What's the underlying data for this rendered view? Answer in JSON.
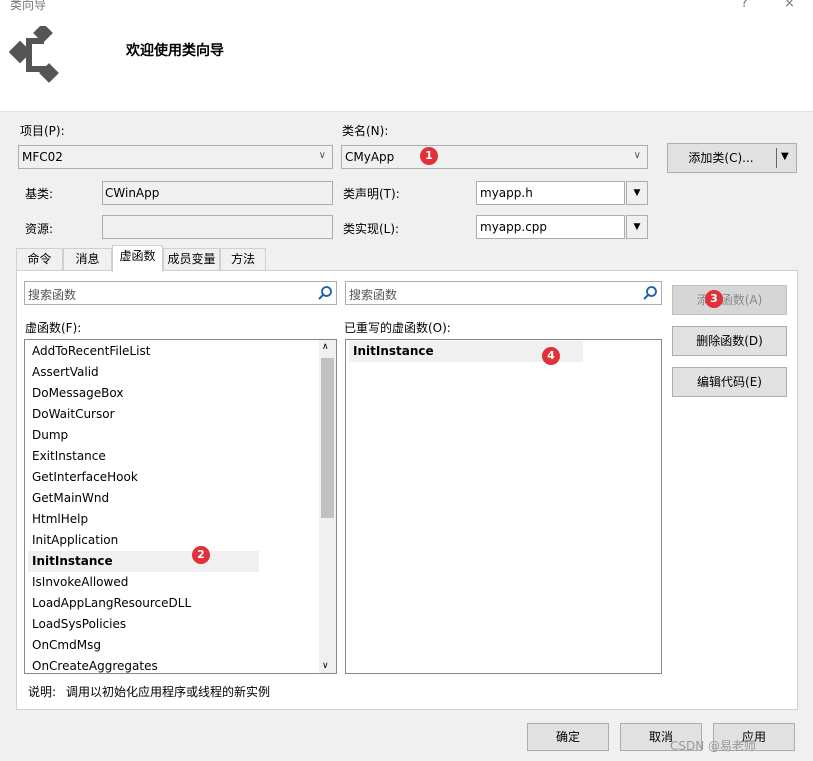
{
  "window": {
    "title": "类向导",
    "help_label": "?",
    "close_label": "×"
  },
  "header": {
    "title": "欢迎使用类向导"
  },
  "form": {
    "project_label": "项目(P):",
    "project_value": "MFC02",
    "class_label": "类名(N):",
    "class_value": "CMyApp",
    "add_class_label": "添加类(C)...",
    "base_label": "基类:",
    "base_value": "CWinApp",
    "decl_label": "类声明(T):",
    "decl_value": "myapp.h",
    "resource_label": "资源:",
    "resource_value": "",
    "impl_label": "类实现(L):",
    "impl_value": "myapp.cpp"
  },
  "tabs": [
    "命令",
    "消息",
    "虚函数",
    "成员变量",
    "方法"
  ],
  "active_tab": "虚函数",
  "search": {
    "left_placeholder": "搜索函数",
    "right_placeholder": "搜索函数"
  },
  "virtual_functions": {
    "label": "虚函数(F):",
    "items": [
      "AddToRecentFileList",
      "AssertValid",
      "DoMessageBox",
      "DoWaitCursor",
      "Dump",
      "ExitInstance",
      "GetInterfaceHook",
      "GetMainWnd",
      "HtmlHelp",
      "InitApplication",
      "InitInstance",
      "IsInvokeAllowed",
      "LoadAppLangResourceDLL",
      "LoadSysPolicies",
      "OnCmdMsg",
      "OnCreateAggregates"
    ],
    "selected": "InitInstance"
  },
  "overridden": {
    "label": "已重写的虚函数(O):",
    "items": [
      "InitInstance"
    ]
  },
  "actions": {
    "add_function": "添加函数(A)",
    "delete_function": "删除函数(D)",
    "edit_code": "编辑代码(E)"
  },
  "description": {
    "label": "说明:",
    "text": "调用以初始化应用程序或线程的新实例"
  },
  "footer": {
    "ok": "确定",
    "cancel": "取消",
    "apply": "应用"
  },
  "watermark": "CSDN @易老师",
  "badges": [
    "1",
    "2",
    "3",
    "4"
  ],
  "colors": {
    "badge": "#e0303a",
    "selection": "#f0f0f0"
  }
}
